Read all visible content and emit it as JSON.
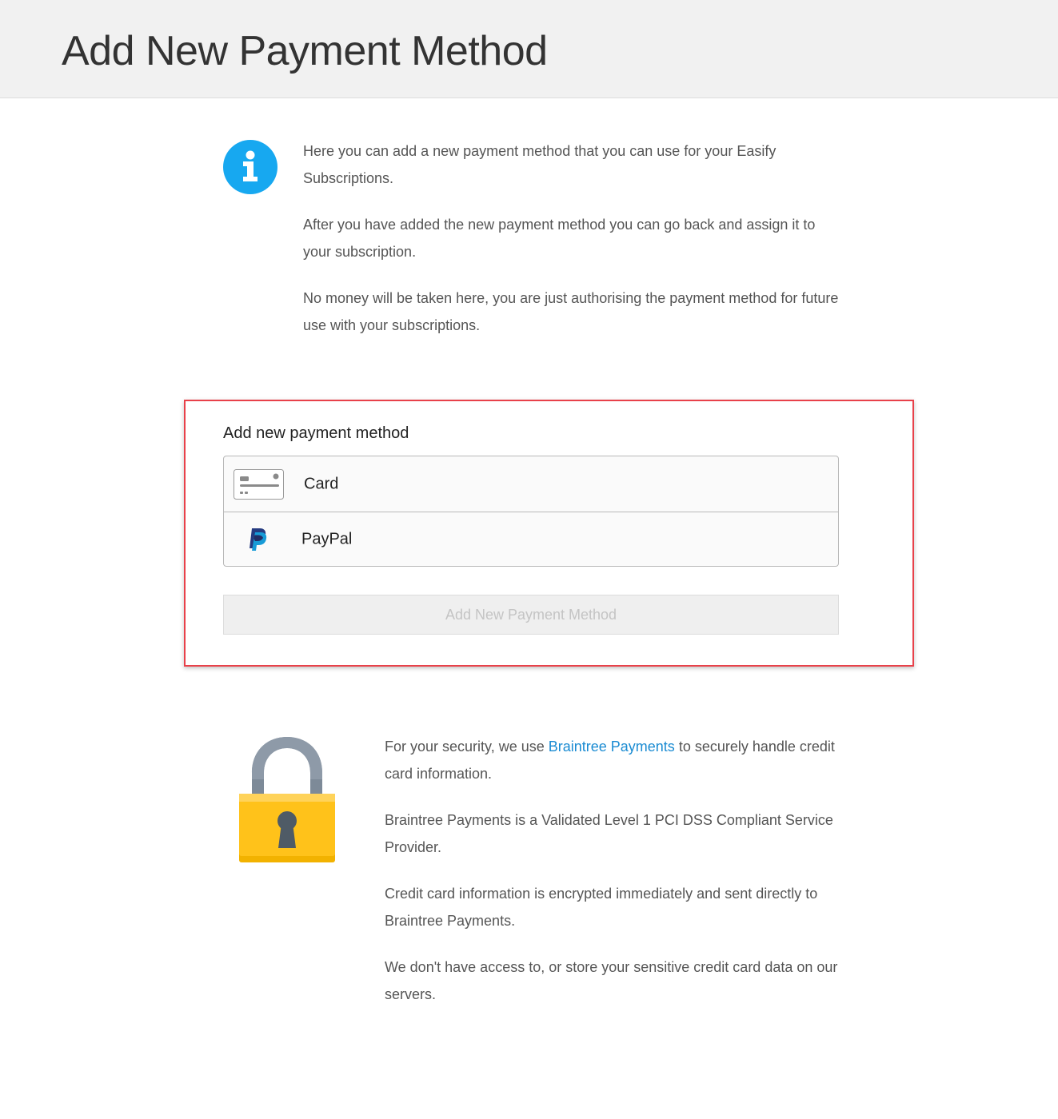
{
  "header": {
    "title": "Add New Payment Method"
  },
  "info": {
    "icon": "info-icon",
    "icon_color": "#17a8f0",
    "paragraphs": [
      "Here you can add a new payment method that you can use for your Easify Subscriptions.",
      "After you have added the new payment method you can go back and assign it to your subscription.",
      "No money will be taken here, you are just authorising the payment method for future use with your subscriptions."
    ]
  },
  "dropin": {
    "highlight_color": "#e8414a",
    "heading": "Add new payment method",
    "options": [
      {
        "label": "Card",
        "icon": "credit-card-icon"
      },
      {
        "label": "PayPal",
        "icon": "paypal-icon"
      }
    ],
    "submit_label": "Add New Payment Method",
    "submit_disabled": true
  },
  "security": {
    "icon": "padlock-icon",
    "p1_before": "For your security, we use ",
    "p1_link": "Braintree Payments",
    "p1_after": " to securely handle credit card information.",
    "paragraphs": [
      "Braintree Payments is a Validated Level 1 PCI DSS Compliant Service Provider.",
      "Credit card information is encrypted immediately and sent directly to Braintree Payments.",
      "We don't have access to, or store your sensitive credit card data on our servers."
    ],
    "link_color": "#1a8bd2"
  }
}
